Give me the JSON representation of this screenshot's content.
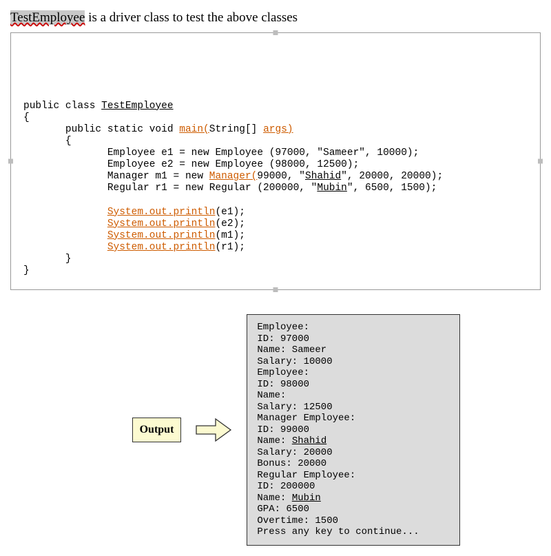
{
  "heading": {
    "highlighted": "TestEmployee",
    "rest": " is a driver class to test the above classes"
  },
  "code": {
    "l1a": "public class ",
    "l1b": "TestEmployee",
    "l2": "{",
    "l3a": "       public static void ",
    "l3b": "main(",
    "l3c": "String[] ",
    "l3d": "args)",
    "l4": "       {",
    "l5": "              Employee e1 = new Employee (97000, \"Sameer\", 10000);",
    "l6": "              Employee e2 = new Employee (98000, 12500);",
    "l7a": "              Manager m1 = new ",
    "l7b": "Manager(",
    "l7c": "99000, \"",
    "l7d": "Shahid",
    "l7e": "\", 20000, 20000);",
    "l8a": "              Regular r1 = new Regular (200000, \"",
    "l8b": "Mubin",
    "l8c": "\", 6500, 1500);",
    "blank": "",
    "l9a": "              ",
    "l9b": "System.out.println",
    "l9c": "(e1);",
    "l10a": "              ",
    "l10b": "System.out.println",
    "l10c": "(e2);",
    "l11a": "              ",
    "l11b": "System.out.println",
    "l11c": "(m1);",
    "l12a": "              ",
    "l12b": "System.out.println",
    "l12c": "(r1);",
    "l13": "       }",
    "l14": "}"
  },
  "output_label": "Output",
  "output": {
    "l1": "Employee:",
    "l2": "ID: 97000",
    "l3": "Name: Sameer",
    "l4": "Salary: 10000",
    "l5": "Employee:",
    "l6": "ID: 98000",
    "l7": "Name:",
    "l8": "Salary: 12500",
    "l9": "Manager Employee:",
    "l10": "ID: 99000",
    "l11a": "Name: ",
    "l11b": "Shahid",
    "l12": "Salary: 20000",
    "l13": "Bonus: 20000",
    "l14": "Regular Employee:",
    "l15": "ID: 200000",
    "l16a": "Name: ",
    "l16b": "Mubin",
    "l17": "GPA: 6500",
    "l18": "Overtime: 1500",
    "l19": "Press any key to continue..."
  }
}
